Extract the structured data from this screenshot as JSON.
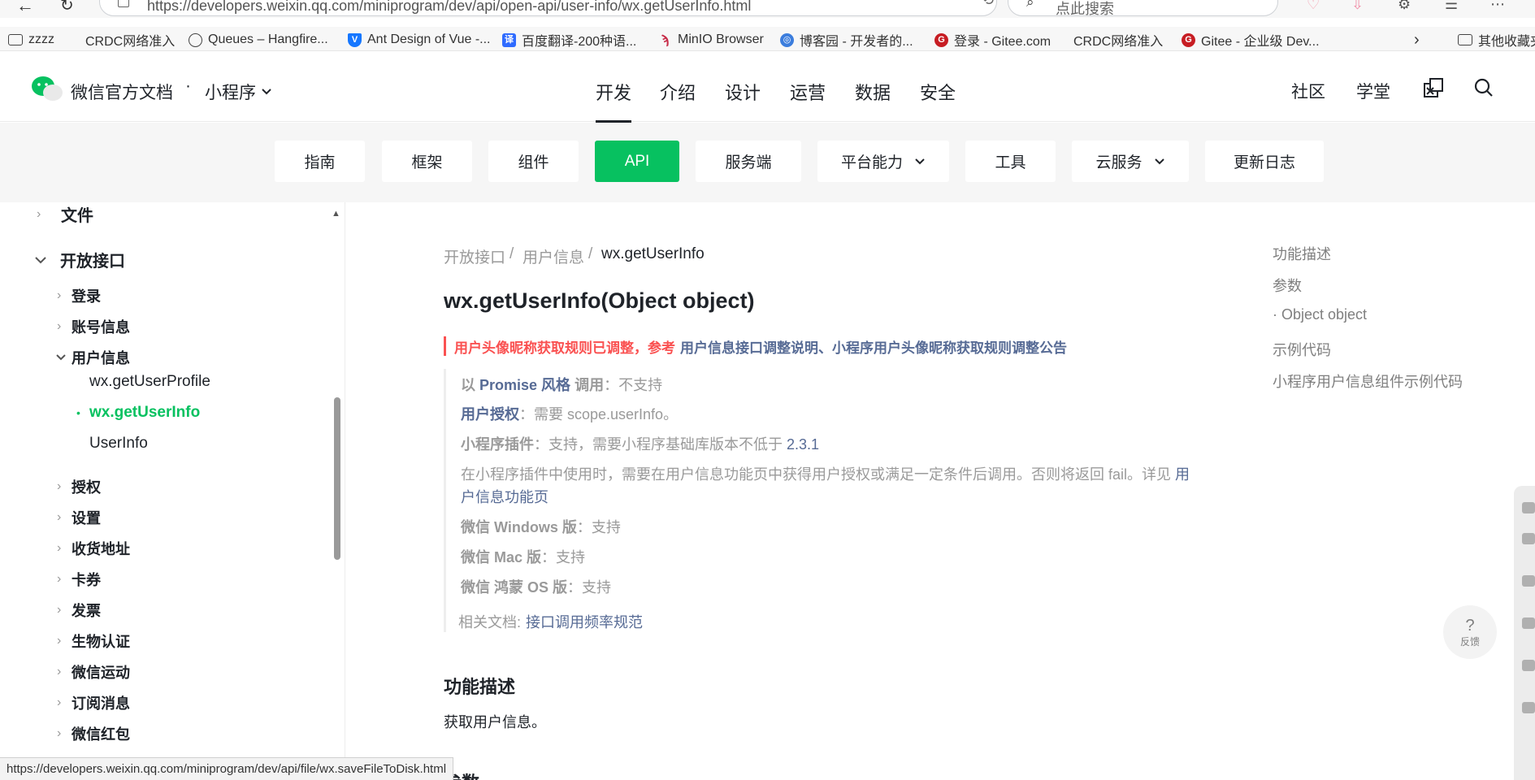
{
  "browser": {
    "url": "https://developers.weixin.qq.com/miniprogram/dev/api/open-api/user-info/wx.getUserInfo.html",
    "search_placeholder": "点此搜索"
  },
  "bookmarks": [
    {
      "label": "zzzz",
      "icon": "folder-icon"
    },
    {
      "label": "CRDC网络准入",
      "icon": "blank-page-icon"
    },
    {
      "label": "Queues – Hangfire...",
      "icon": "globe-icon"
    },
    {
      "label": "Ant Design of Vue -...",
      "icon": "vue-logo-icon"
    },
    {
      "label": "百度翻译-200种语...",
      "icon": "translate-icon"
    },
    {
      "label": "MinIO Browser",
      "icon": "minio-icon"
    },
    {
      "label": "博客园 - 开发者的...",
      "icon": "cnblogs-icon"
    },
    {
      "label": "登录 - Gitee.com",
      "icon": "gitee-icon"
    },
    {
      "label": "CRDC网络准入",
      "icon": "blank-page-icon"
    },
    {
      "label": "Gitee - 企业级 Dev...",
      "icon": "gitee-icon"
    }
  ],
  "bookmarks_other": "其他收藏夹",
  "header": {
    "site_title": "微信官方文档",
    "dot": "·",
    "product": "小程序",
    "nav": [
      "开发",
      "介绍",
      "设计",
      "运营",
      "数据",
      "安全"
    ],
    "right_nav": [
      "社区",
      "学堂"
    ]
  },
  "categories": [
    {
      "label": "指南",
      "dropdown": false
    },
    {
      "label": "框架",
      "dropdown": false
    },
    {
      "label": "组件",
      "dropdown": false
    },
    {
      "label": "API",
      "dropdown": false
    },
    {
      "label": "服务端",
      "dropdown": false
    },
    {
      "label": "平台能力",
      "dropdown": true
    },
    {
      "label": "工具",
      "dropdown": false
    },
    {
      "label": "云服务",
      "dropdown": true
    },
    {
      "label": "更新日志",
      "dropdown": false
    }
  ],
  "sidebar": {
    "top_item": "文件",
    "section": "开放接口",
    "items": {
      "login": "登录",
      "account": "账号信息",
      "userinfo": "用户信息",
      "sub1": "wx.getUserProfile",
      "sub2": "wx.getUserInfo",
      "sub3": "UserInfo",
      "auth": "授权",
      "settings": "设置",
      "address": "收货地址",
      "card": "卡券",
      "invoice": "发票",
      "bio": "生物认证",
      "werun": "微信运动",
      "subscribe": "订阅消息",
      "redpacket": "微信红包"
    }
  },
  "content": {
    "breadcrumb": [
      "开放接口",
      "/",
      "用户信息",
      "/",
      "wx.getUserInfo"
    ],
    "title": "wx.getUserInfo(Object object)",
    "notice_red": "用户头像昵称获取规则已调整，参考",
    "notice_link1": "用户信息接口调整说明",
    "notice_sep": "、",
    "notice_link2": "小程序用户头像昵称获取规则调整公告",
    "promise_pre": "以",
    "promise_key": "Promise 风格",
    "promise_post": "调用",
    "promise_val": "：不支持",
    "auth_key": "用户授权",
    "auth_val": "：需要 scope.userInfo。",
    "plugin_key": "小程序插件",
    "plugin_val": "：支持，需要小程序基础库版本不低于",
    "plugin_ver": "2.3.1",
    "plugin_note": "在小程序插件中使用时，需要在用户信息功能页中获得用户授权或满足一定条件后调用。否则将返回 fail。详见",
    "plugin_link_a": "用",
    "plugin_link_b": "户信息功能页",
    "win_key": "微信 Windows 版",
    "win_val": "：支持",
    "mac_key": "微信 Mac 版",
    "mac_val": "：支持",
    "hm_key": "微信 鸿蒙 OS 版",
    "hm_val": "：支持",
    "related_label": "相关文档:",
    "related_link": "接口调用频率规范",
    "sec_func": "功能描述",
    "sec_func_text": "获取用户信息。",
    "sec_params": "参数"
  },
  "toc": [
    "功能描述",
    "参数",
    "· Object object",
    "示例代码",
    "小程序用户信息组件示例代码"
  ],
  "feedback": {
    "icon": "?",
    "label": "反馈"
  },
  "status_url": "https://developers.weixin.qq.com/miniprogram/dev/api/file/wx.saveFileToDisk.html"
}
